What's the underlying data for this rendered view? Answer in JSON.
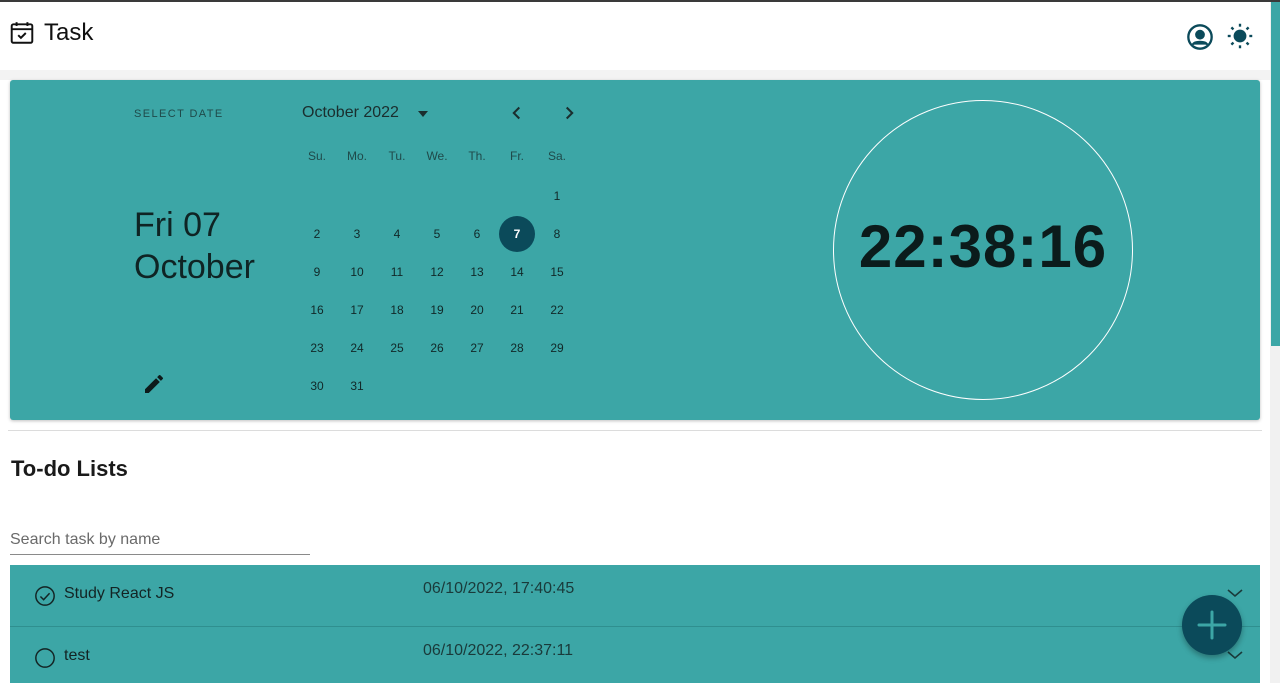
{
  "app": {
    "title": "Task",
    "icons": {
      "logo": "calendar-check-icon",
      "user": "account-circle-icon",
      "theme": "sun-icon"
    }
  },
  "date_picker": {
    "select_date_label": "SELECT DATE",
    "selected_weekday_day": "Fri 07",
    "selected_month": "October",
    "month_year": "October 2022",
    "weekdays": [
      "Su.",
      "Mo.",
      "Tu.",
      "We.",
      "Th.",
      "Fr.",
      "Sa."
    ],
    "days": [
      "1",
      "2",
      "3",
      "4",
      "5",
      "6",
      "7",
      "8",
      "9",
      "10",
      "11",
      "12",
      "13",
      "14",
      "15",
      "16",
      "17",
      "18",
      "19",
      "20",
      "21",
      "22",
      "23",
      "24",
      "25",
      "26",
      "27",
      "28",
      "29",
      "30",
      "31"
    ],
    "first_day_column": 6,
    "selected_day": "7",
    "icons": {
      "edit": "pencil-icon",
      "dropdown": "caret-down-icon",
      "prev": "chevron-left-icon",
      "next": "chevron-right-icon"
    }
  },
  "clock": {
    "time": "22:38:16"
  },
  "todo": {
    "title": "To-do Lists",
    "search_placeholder": "Search task by name",
    "tasks": [
      {
        "name": "Study React JS",
        "timestamp": "06/10/2022, 17:40:45",
        "completed": true
      },
      {
        "name": "test",
        "timestamp": "06/10/2022, 22:37:11",
        "completed": false
      }
    ]
  },
  "fab": {
    "icon": "plus-icon"
  },
  "colors": {
    "accent": "#3ca6a6",
    "primary_dark": "#0b4a5a",
    "background": "#ffffff"
  }
}
